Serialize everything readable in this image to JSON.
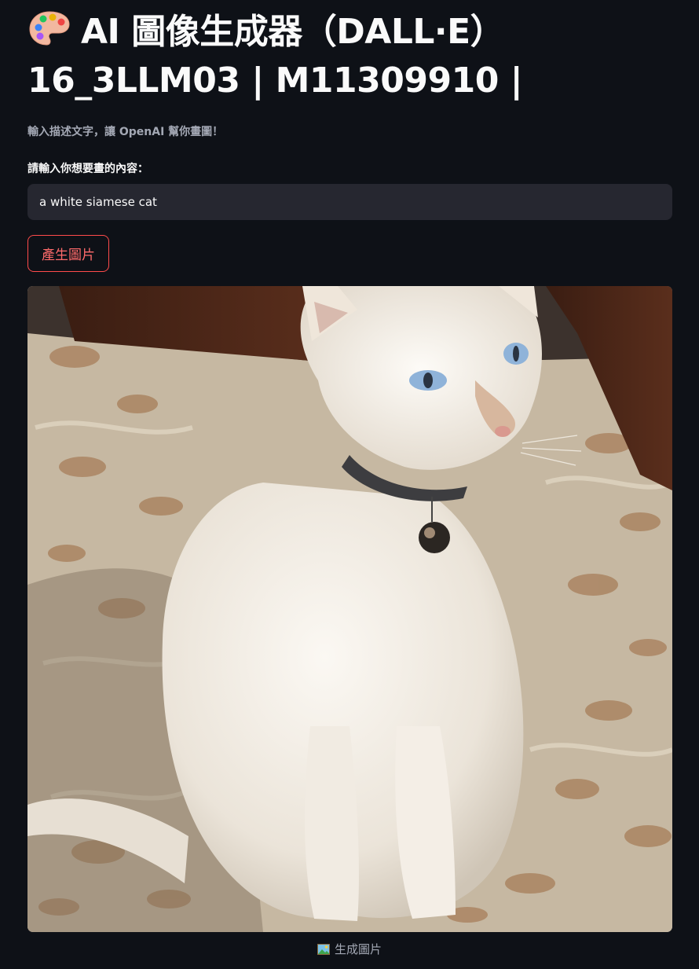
{
  "header": {
    "title_line1": "AI 圖像生成器（DALL·E）",
    "title_line2": "16_3LLM03 | M11309910 |",
    "title_icon": "palette-icon",
    "subtitle": "輸入描述文字，讓 OpenAI 幫你畫圖！"
  },
  "form": {
    "prompt_label": "請輸入你想要畫的內容：",
    "prompt_value": "a white siamese cat",
    "generate_button_label": "產生圖片"
  },
  "result": {
    "image_subject": "a white siamese cat",
    "caption_icon": "framed-picture-icon",
    "caption": "生成圖片"
  },
  "colors": {
    "background": "#0e1117",
    "input_background": "#262730",
    "button_border": "#ff4b4b",
    "button_text": "#ff6b6b",
    "muted_text": "#a3a8b4"
  }
}
